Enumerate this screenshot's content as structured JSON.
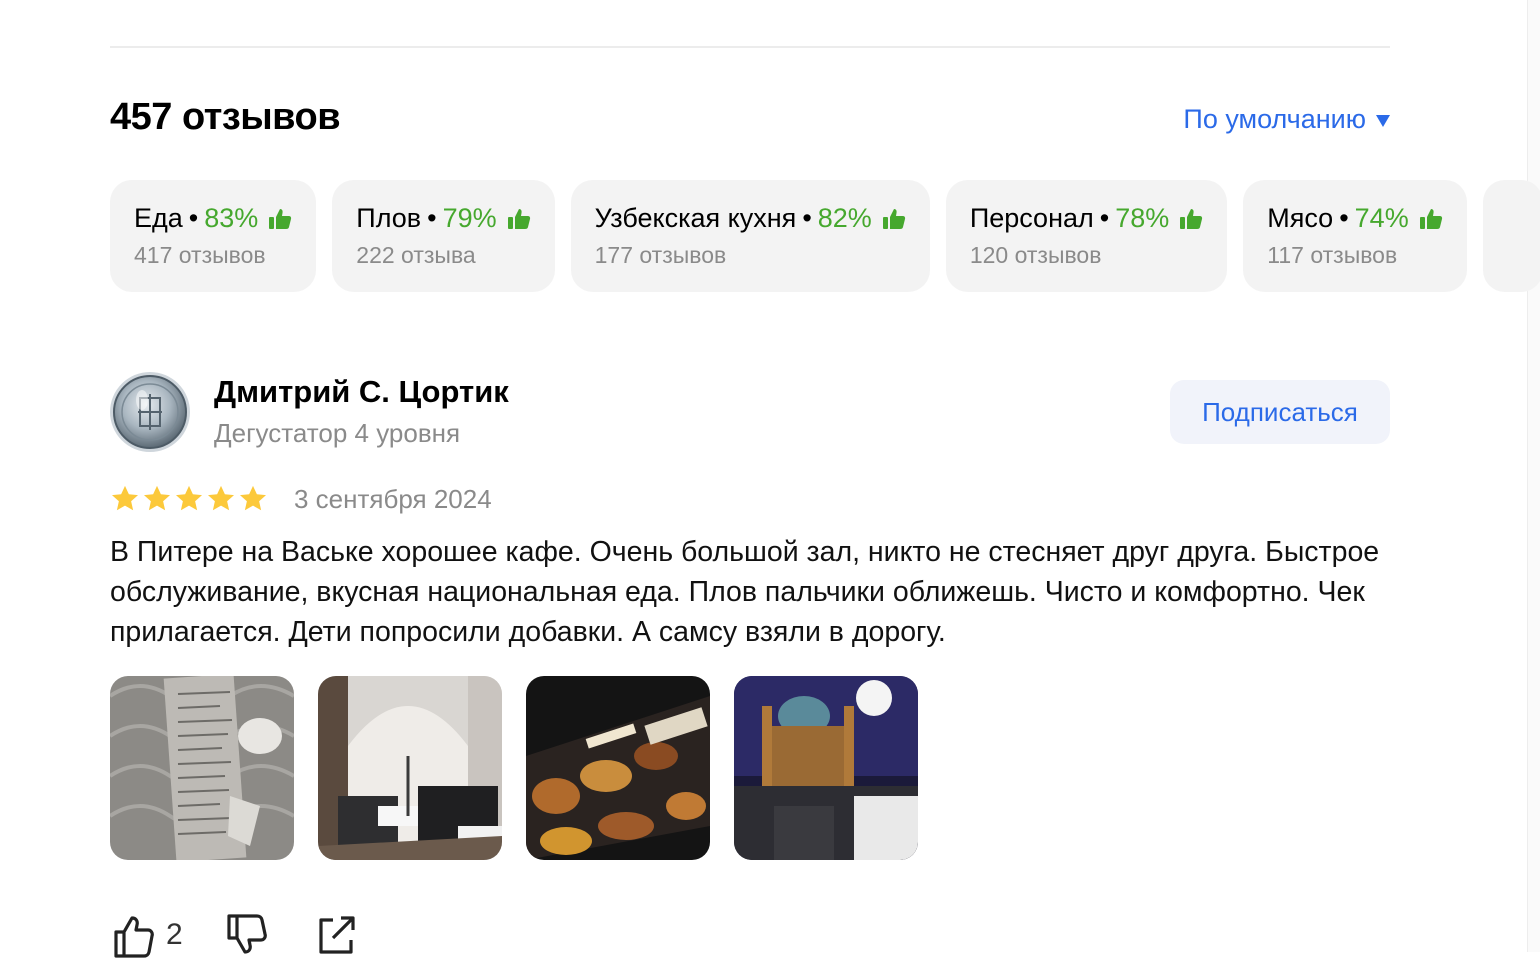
{
  "reviews": {
    "count_title": "457 отзывов",
    "sort_label": "По умолчанию"
  },
  "aspects": [
    {
      "name": "Еда",
      "percent": "83%",
      "count": "417 отзывов"
    },
    {
      "name": "Плов",
      "percent": "79%",
      "count": "222 отзыва"
    },
    {
      "name": "Узбекская кухня",
      "percent": "82%",
      "count": "177 отзывов"
    },
    {
      "name": "Персонал",
      "percent": "78%",
      "count": "120 отзывов"
    },
    {
      "name": "Мясо",
      "percent": "74%",
      "count": "117 отзывов"
    }
  ],
  "review": {
    "author_name": "Дмитрий С. Цортик",
    "author_level": "Дегустатор 4 уровня",
    "subscribe_label": "Подписаться",
    "rating": 5,
    "date": "3 сентября 2024",
    "text": "В Питере на Ваське хорошее кафе. Очень большой зал, никто не стесняет друг друга. Быстрое обслуживание, вкусная национальная еда. Плов пальчики оближешь. Чисто и комфортно. Чек прилагается. Дети попросили добавки. А самсу взяли в дорогу.",
    "likes": "2"
  },
  "colors": {
    "accent": "#2b6ae8",
    "positive": "#46a82e",
    "star": "#fcc93b",
    "muted": "#8a8a8a",
    "chip_bg": "#f3f3f3"
  },
  "icons": {
    "sort": "triangle-down-icon",
    "aspect": "thumb-up-icon",
    "like": "thumb-up-icon",
    "dislike": "thumb-down-icon",
    "share": "share-icon"
  }
}
